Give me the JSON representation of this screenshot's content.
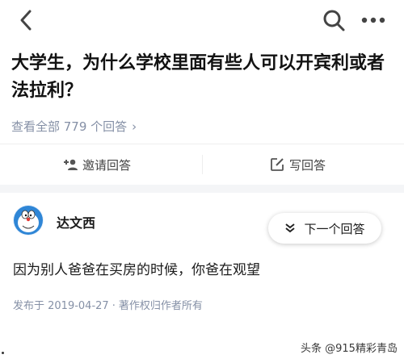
{
  "header": {
    "back_icon": "chevron-left-icon",
    "search_icon": "search-icon",
    "more_icon": "more-dots-icon"
  },
  "question": {
    "title": "大学生，为什么学校里面有些人可以开宾利或者法拉利？"
  },
  "answers_link": {
    "label": "查看全部 779 个回答",
    "chevron": "›"
  },
  "actions": {
    "invite_label": "邀请回答",
    "write_label": "写回答"
  },
  "answer": {
    "author": "达文西",
    "next_label": "下一个回答",
    "content": "因为别人爸爸在买房的时候，你爸在观望",
    "published": "发布于 2019-04-27",
    "separator": "·",
    "copyright": "著作权归作者所有"
  },
  "watermark": {
    "text": "头条 @915精彩青岛"
  },
  "colors": {
    "accent": "#0066ff",
    "muted": "#8590a6",
    "band": "#f4f5f7"
  }
}
